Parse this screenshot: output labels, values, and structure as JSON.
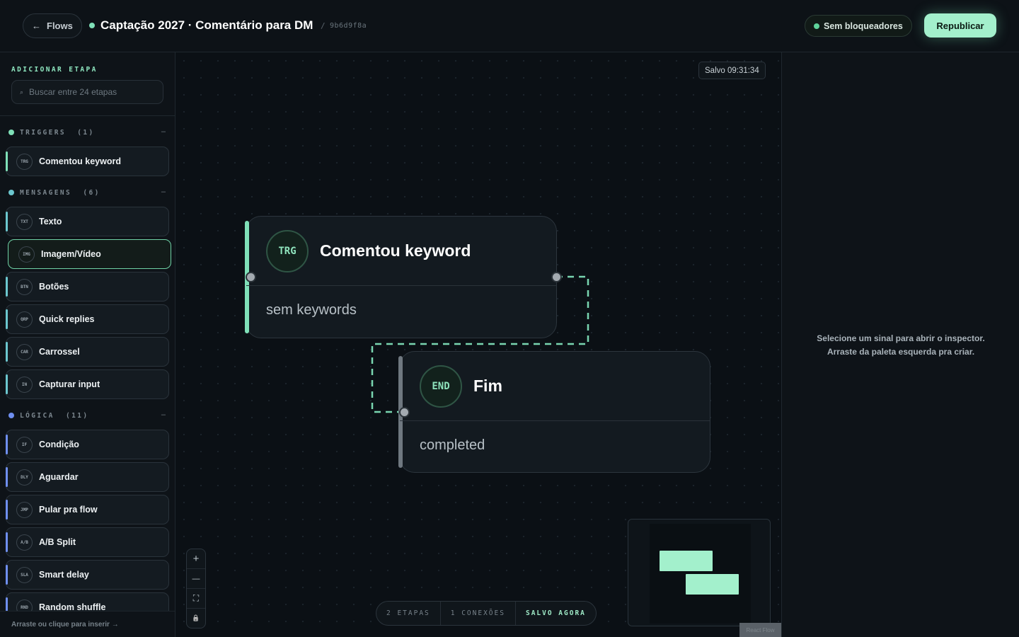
{
  "header": {
    "back_label": "Flows",
    "back_icon": "arrow-left-icon",
    "title": "Captação 2027 · Comentário para DM",
    "separator": "/",
    "hash": "9b6d9f8a",
    "status_color": "#7fe0b8",
    "blockers_label": "Sem bloqueadores",
    "publish_label": "Republicar",
    "accent": "#a3f0cc"
  },
  "sidebar": {
    "add_step_title": "ADICIONAR ETAPA",
    "search_placeholder": "Buscar entre 24 etapas",
    "search_icon": "search-icon",
    "footer_hint": "Arraste ou clique para inserir →",
    "sections": [
      {
        "label": "TRIGGERS",
        "count": "(1)",
        "color": "#7fe0b8",
        "collapse": "–",
        "items": [
          {
            "tag": "TRG",
            "name": "Comentou keyword"
          }
        ]
      },
      {
        "label": "MENSAGENS",
        "count": "(6)",
        "color": "#6cc7cf",
        "collapse": "–",
        "items": [
          {
            "tag": "TXT",
            "name": "Texto"
          },
          {
            "tag": "IMG",
            "name": "Imagem/Vídeo"
          },
          {
            "tag": "BTN",
            "name": "Botões"
          },
          {
            "tag": "QRP",
            "name": "Quick replies"
          },
          {
            "tag": "CAR",
            "name": "Carrossel"
          },
          {
            "tag": "IN",
            "name": "Capturar input"
          }
        ]
      },
      {
        "label": "LÓGICA",
        "count": "(11)",
        "color": "#6f8ff0",
        "collapse": "–",
        "items": [
          {
            "tag": "IF",
            "name": "Condição"
          },
          {
            "tag": "DLY",
            "name": "Aguardar"
          },
          {
            "tag": "JMP",
            "name": "Pular pra flow"
          },
          {
            "tag": "A/B",
            "name": "A/B Split"
          },
          {
            "tag": "SLA",
            "name": "Smart delay"
          },
          {
            "tag": "RND",
            "name": "Random shuffle"
          }
        ]
      }
    ]
  },
  "canvas": {
    "saved_label": "Salvo 09:31:34",
    "nodes": [
      {
        "tag": "TRG",
        "title": "Comentou keyword",
        "subtitle": "sem keywords",
        "color": "#7fe0b8"
      },
      {
        "tag": "END",
        "title": "Fim",
        "subtitle": "completed",
        "color": "#6f7880"
      }
    ],
    "edge_color": "#7fe0b8",
    "zoom_controls": [
      {
        "name": "zoom-in-button",
        "icon": "plus-icon",
        "glyph": "+"
      },
      {
        "name": "zoom-out-button",
        "icon": "minus-icon",
        "glyph": "—"
      },
      {
        "name": "fit-view-button",
        "icon": "fit-view-icon",
        "glyph": "⛶"
      },
      {
        "name": "lock-button",
        "icon": "lock-icon",
        "glyph": "🔒"
      }
    ],
    "stats": {
      "steps": "2 ETAPAS",
      "connections": "1 CONEXÕES",
      "saved": "SALVO AGORA"
    },
    "attribution": "React Flow"
  },
  "inspector": {
    "hint_line1": "Selecione um sinal para abrir o inspector.",
    "hint_line2": "Arraste da paleta esquerda pra criar."
  }
}
